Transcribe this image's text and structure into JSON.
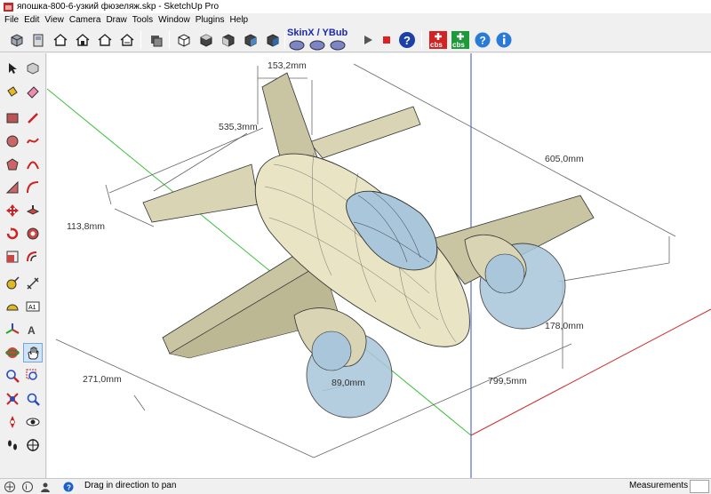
{
  "app": {
    "title": "япошка-800-6-узкий фюзеляж.skp - SketchUp Pro"
  },
  "menu": {
    "items": [
      "File",
      "Edit",
      "View",
      "Camera",
      "Draw",
      "Tools",
      "Window",
      "Plugins",
      "Help"
    ]
  },
  "toolbar": {
    "skinx_label": "SkinX / YBub",
    "cbs_label_1": "cbs",
    "cbs_label_2": "cbs"
  },
  "dimensions": {
    "d1": "153,2mm",
    "d2": "535,3mm",
    "d3": "605,0mm",
    "d4": "113,8mm",
    "d5": "178,0mm",
    "d6": "271,0mm",
    "d7": "89,0mm",
    "d8": "799,5mm"
  },
  "status": {
    "hint": "Drag in direction to pan",
    "measurements_label": "Measurements"
  },
  "colors": {
    "body": "#e8e4c4",
    "body_shade": "#bdb894",
    "glass": "#a9c6da",
    "axis_blue": "#3a4fb8",
    "axis_green": "#3cbf3c",
    "axis_red": "#d03030"
  }
}
